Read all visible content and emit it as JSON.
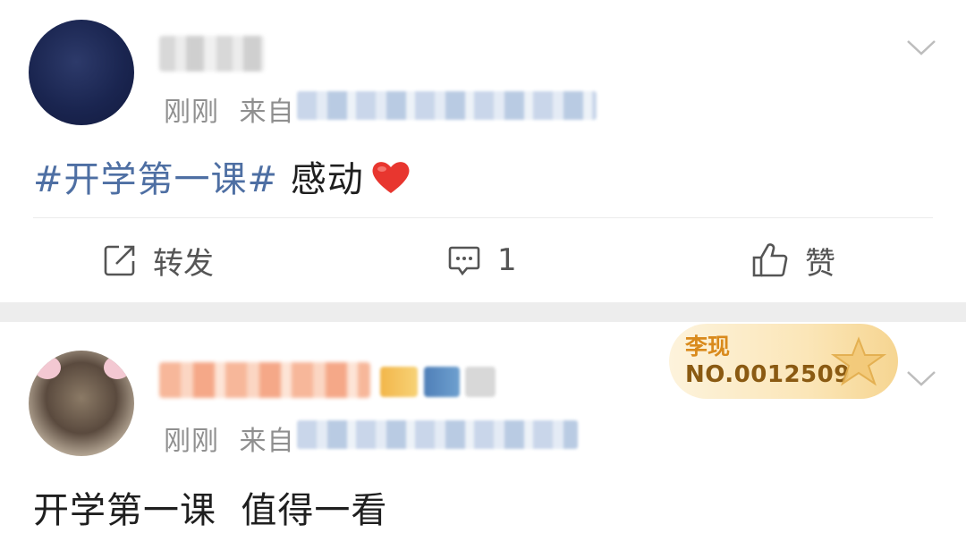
{
  "posts": [
    {
      "time": "刚刚",
      "source_prefix": "来自",
      "content_topic": "#开学第一课#",
      "content_text": " 感动",
      "actions": {
        "repost_label": "转发",
        "comment_count": "1",
        "like_label": "赞"
      }
    },
    {
      "time": "刚刚",
      "source_prefix": "来自",
      "content_text": "开学第一课  值得一看",
      "medal": {
        "title": "李现",
        "number": "NO.0012509"
      }
    }
  ],
  "icons": {
    "repost": "repost-icon",
    "comment": "comment-icon",
    "like": "thumbs-up-icon",
    "more": "chevron-down-icon",
    "heart": "heart-emoji-icon"
  },
  "colors": {
    "topic_link": "#4e6fa3",
    "meta_text": "#8f8f8f",
    "separator": "#ededed",
    "medal_gold": "#d98a1c"
  }
}
